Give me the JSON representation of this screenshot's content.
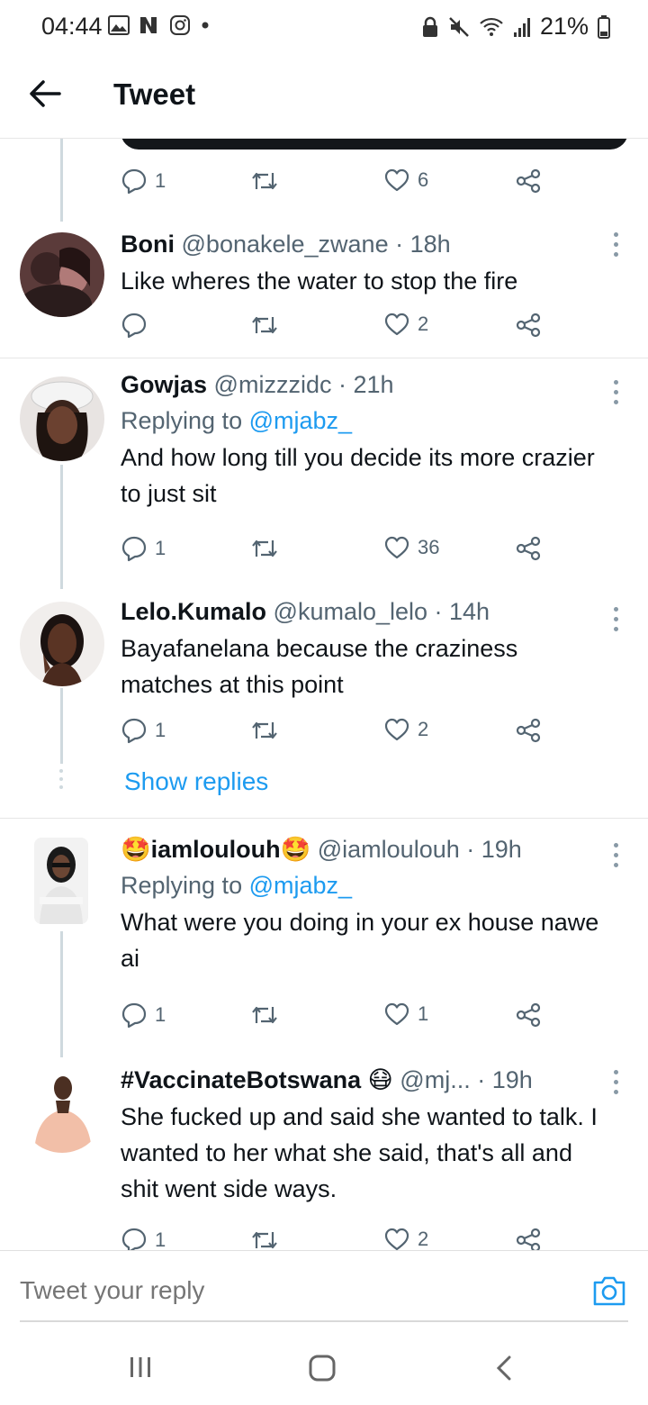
{
  "status_bar": {
    "time": "04:44",
    "battery": "21%",
    "left_icons": [
      "gallery-icon",
      "news-icon",
      "instagram-icon",
      "dot-icon"
    ],
    "right_icons": [
      "lock-icon",
      "mute-icon",
      "wifi-icon",
      "signal-icon",
      "battery-icon"
    ]
  },
  "header": {
    "title": "Tweet"
  },
  "top_actions": {
    "replies": "1",
    "likes": "6"
  },
  "tweets": [
    {
      "name": "Boni",
      "handle": "@bonakele_zwane · 18h",
      "text": "Like wheres the water to stop the fire",
      "replies": "",
      "likes": "2"
    },
    {
      "name": "Gowjas",
      "handle": "@mizzzidc · 21h",
      "replying_prefix": "Replying to ",
      "replying_to": "@mjabz_",
      "text": "And how long till you decide its more crazier to just sit",
      "replies": "1",
      "likes": "36"
    },
    {
      "name": "Lelo.Kumalo",
      "handle": "@kumalo_lelo · 14h",
      "text": "Bayafanelana because the craziness matches at this point",
      "replies": "1",
      "likes": "2"
    },
    {
      "name": "🤩iamloulouh🤩",
      "handle": "@iamloulouh · 19h",
      "replying_prefix": "Replying to ",
      "replying_to": "@mjabz_",
      "text": "What were you doing in your ex house nawe ai",
      "replies": "1",
      "likes": "1"
    },
    {
      "name": "#VaccinateBotswana 😷",
      "handle": "@mj...   · 19h",
      "text": "She fucked up and said she wanted to talk. I wanted to her what she said, that's all and shit went side ways.",
      "replies": "1",
      "likes": "2"
    }
  ],
  "show_replies": "Show replies",
  "reply_bar": {
    "placeholder": "Tweet your reply"
  },
  "colors": {
    "accent": "#1d9bf0",
    "secondary_text": "#536471",
    "thread_line": "#cfd9de"
  }
}
